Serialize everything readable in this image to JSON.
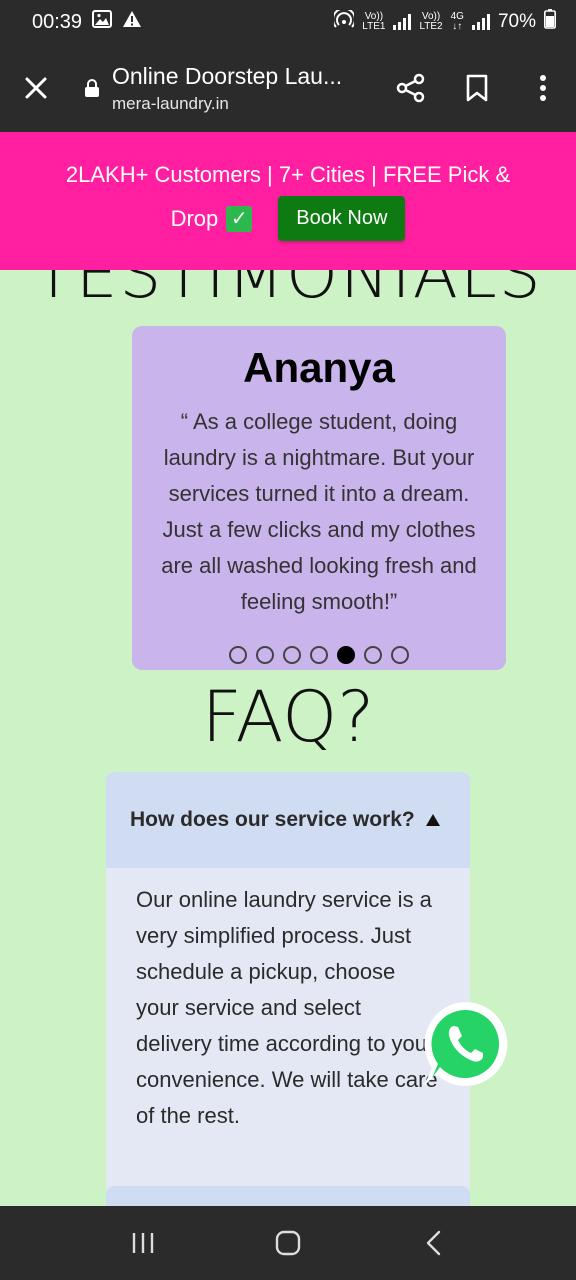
{
  "status_bar": {
    "time": "00:39",
    "sim1_label_top": "Vo))",
    "sim1_label_bottom": "LTE1",
    "sim2_label_top": "Vo))",
    "sim2_label_bottom": "LTE2",
    "network_type": "4G",
    "battery": "70%",
    "icons": [
      "gallery-icon",
      "alert-icon",
      "hotspot-icon",
      "signal-icon",
      "battery-icon"
    ]
  },
  "browser": {
    "title": "Online Doorstep Lau...",
    "domain": "mera-laundry.in",
    "icons": [
      "close-icon",
      "lock-icon",
      "share-icon",
      "bookmark-icon",
      "more-icon"
    ]
  },
  "promo": {
    "line1": "2LAKH+ Customers | 7+ Cities | FREE Pick &",
    "line2": "Drop",
    "check_glyph": "✓",
    "book_label": "Book Now",
    "bg_color": "#ff1fa0",
    "button_color": "#0e7a12"
  },
  "testimonials": {
    "heading": "TESTIMONIALS",
    "name": "Ananya",
    "quote": "“ As a college student, doing laundry is a nightmare. But your services turned it into a dream. Just a few clicks and my clothes are all washed looking fresh and feeling smooth!”",
    "dot_count": 7,
    "active_dot": 5,
    "card_color": "#c9b4ec"
  },
  "faq": {
    "heading": "FAQ?",
    "question": "How does our service work?",
    "answer": "Our online laundry service is a very simplified process. Just schedule a pickup, choose your service and select delivery time according to your convenience. We will take care of the rest.",
    "expanded": true
  },
  "floating": {
    "icon": "whatsapp-icon",
    "color": "#25d366"
  },
  "nav": {
    "icons": [
      "recents-icon",
      "home-icon",
      "back-icon"
    ]
  },
  "colors": {
    "page_bg": "#cdf2c5",
    "system_bar": "#2b2b2b"
  }
}
